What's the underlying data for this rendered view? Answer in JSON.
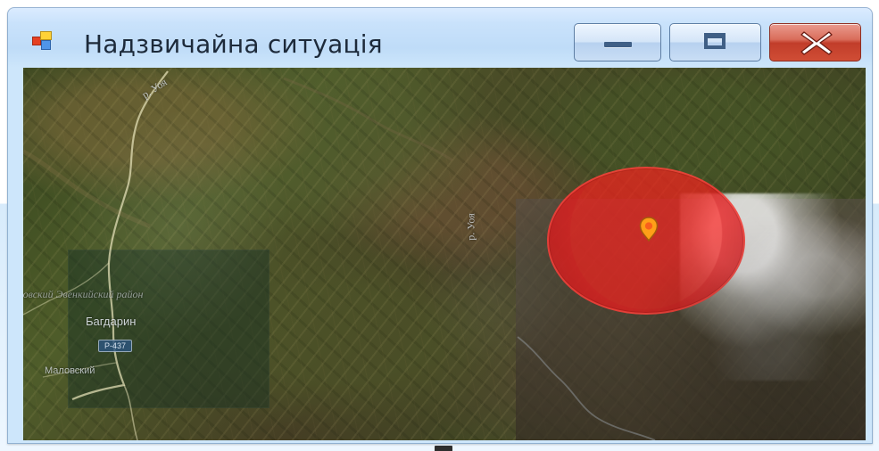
{
  "window": {
    "title": "Надзвичайна ситуація"
  },
  "controls": {
    "minimize_icon": "minimize-icon",
    "maximize_icon": "maximize-icon",
    "close_icon": "close-icon"
  },
  "map": {
    "labels": {
      "top_river": "р. Уоя",
      "vertical_river": "р. Уоя",
      "district": "товский Эвенкийский район",
      "town": "Багдарин",
      "road": "Р-437",
      "small_town": "Маловский"
    },
    "emergency": {
      "marker_icon": "location-pin-icon",
      "zone_color": "#e71f1f",
      "marker_color": "#ff9f18"
    }
  }
}
